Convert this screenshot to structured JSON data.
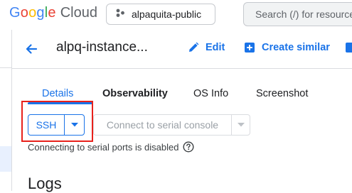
{
  "topbar": {
    "logo_google": "Google",
    "logo_cloud": "Cloud",
    "project_name": "alpaquita-public",
    "search_placeholder": "Search (/) for resources"
  },
  "header": {
    "instance_name": "alpq-instance...",
    "edit_label": "Edit",
    "create_similar_label": "Create similar"
  },
  "tabs": [
    {
      "label": "Details",
      "active": true
    },
    {
      "label": "Observability"
    },
    {
      "label": "OS Info"
    },
    {
      "label": "Screenshot"
    }
  ],
  "connect": {
    "ssh_label": "SSH",
    "serial_label": "Connect to serial console",
    "serial_note": "Connecting to serial ports is disabled"
  },
  "sections": {
    "logs_title": "Logs"
  },
  "colors": {
    "accent": "#1a73e8",
    "highlight": "#e8211b"
  }
}
